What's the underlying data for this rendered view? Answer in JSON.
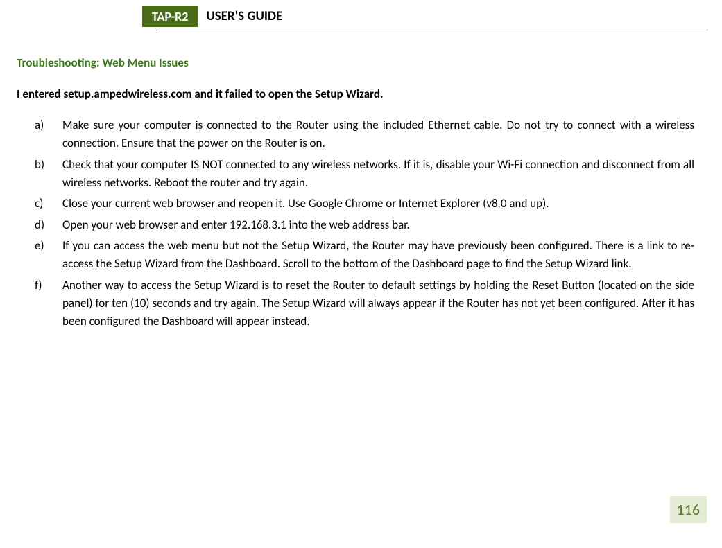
{
  "header": {
    "badge": "TAP-R2",
    "title": "USER'S GUIDE"
  },
  "section_heading": "Troubleshooting: Web Menu Issues",
  "question": "I entered setup.ampedwireless.com and it failed to open the Setup Wizard.",
  "items": [
    {
      "marker": "a)",
      "text": "Make sure your computer is connected to the Router using the included Ethernet cable. Do not try to connect with a wireless connection. Ensure that the power on the Router is on."
    },
    {
      "marker": "b)",
      "text": "Check that your computer IS NOT connected to any wireless networks. If it is, disable your Wi-Fi connection and disconnect from all wireless networks. Reboot the router and try again."
    },
    {
      "marker": "c)",
      "text": "Close your current web browser and reopen it.  Use Google Chrome or Internet Explorer (v8.0 and up)."
    },
    {
      "marker": "d)",
      "text": "Open your web browser and enter 192.168.3.1 into the web address bar."
    },
    {
      "marker": "e)",
      "text": "If you can access the web menu but not the Setup Wizard, the Router may have previously been configured.  There is a link to re-access the Setup Wizard from the Dashboard.  Scroll to the bottom of the Dashboard page to find the Setup Wizard link."
    },
    {
      "marker": "f)",
      "text": "Another way to access the Setup Wizard is to reset the Router to default settings by holding the Reset Button (located on the side panel) for ten (10) seconds and try again.  The Setup Wizard will always appear if the Router has not yet been configured.  After it has been configured the Dashboard will appear instead."
    }
  ],
  "page_number": "116"
}
